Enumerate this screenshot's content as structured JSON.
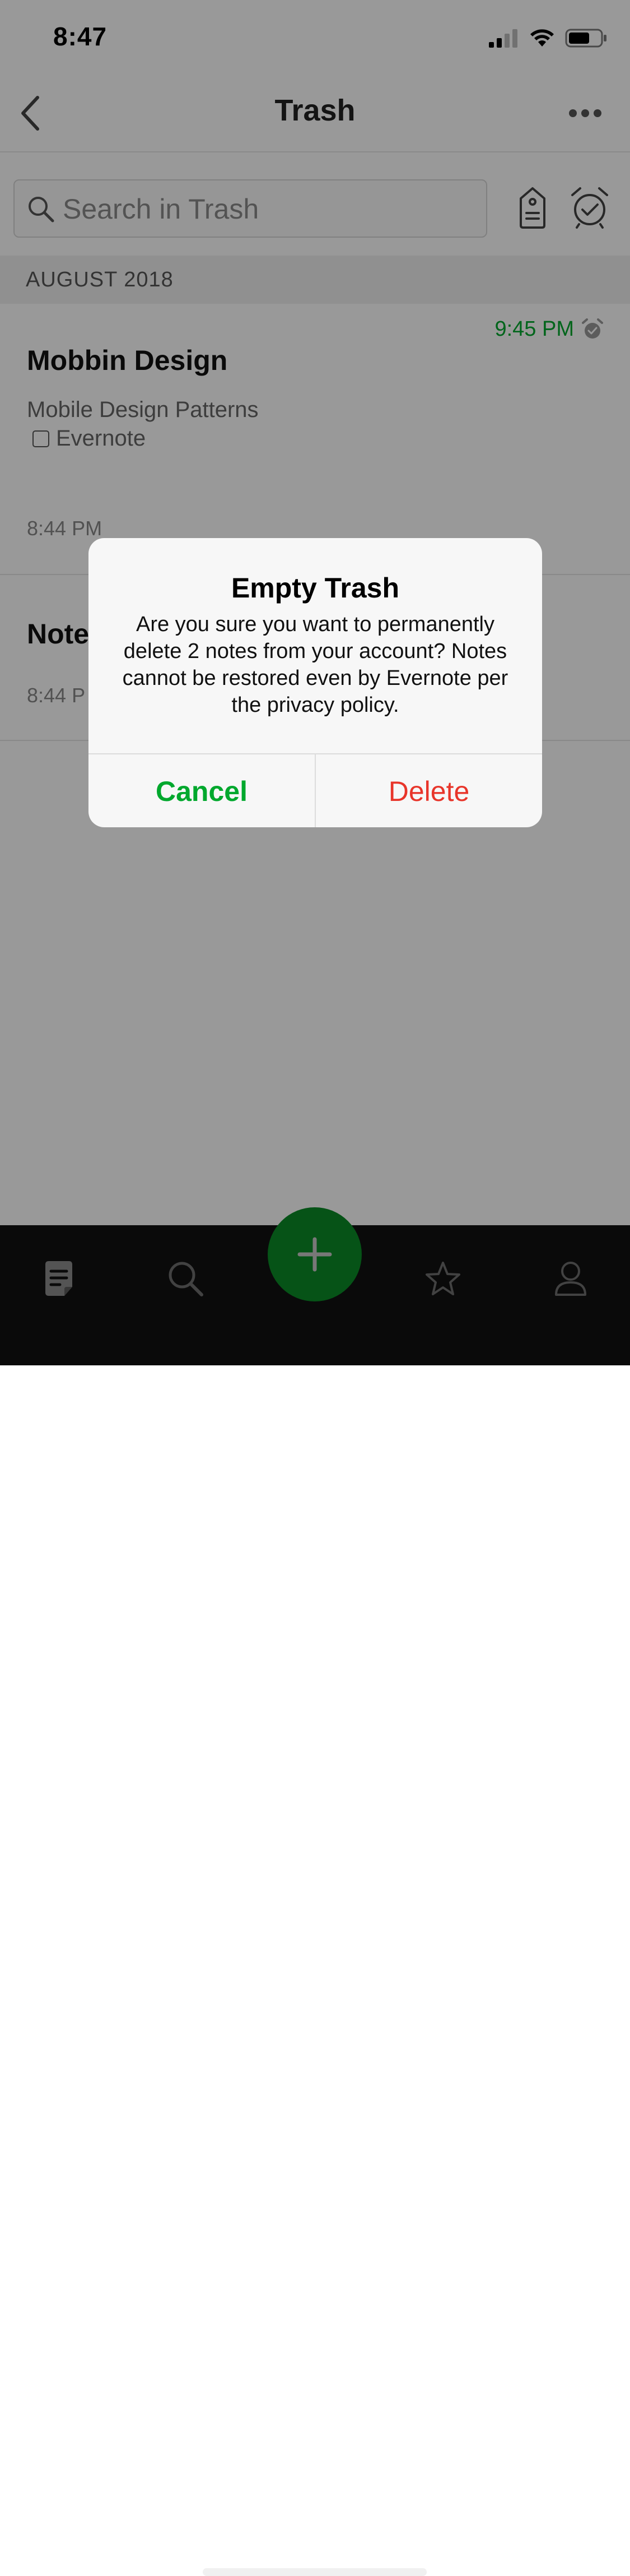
{
  "status_bar": {
    "time": "8:47"
  },
  "nav": {
    "title": "Trash"
  },
  "search": {
    "placeholder": "Search in Trash"
  },
  "section": {
    "label": "AUGUST 2018"
  },
  "notes": [
    {
      "title": "Mobbin Design",
      "reminder_time": "9:45 PM",
      "snippet": "Mobile Design Patterns",
      "checklist_label": "Evernote",
      "time": "8:44 PM"
    },
    {
      "title": "Note",
      "time": "8:44 P"
    }
  ],
  "dialog": {
    "title": "Empty Trash",
    "message": "Are you sure you want to permanently delete 2 notes from your account? Notes cannot be restored even by Evernote per the privacy policy.",
    "cancel_label": "Cancel",
    "delete_label": "Delete"
  },
  "colors": {
    "accent_green": "#00a82d",
    "fab_green": "#0a8a27",
    "destructive_red": "#e8352a",
    "tab_bar_bg": "#111111"
  },
  "icons": {
    "back": "chevron-left-icon",
    "more": "more-horizontal-icon",
    "search": "search-icon",
    "tag": "tag-icon",
    "reminder": "alarm-clock-icon",
    "tabs": [
      "notes-icon",
      "search-icon",
      "plus-icon",
      "star-icon",
      "user-icon"
    ]
  }
}
